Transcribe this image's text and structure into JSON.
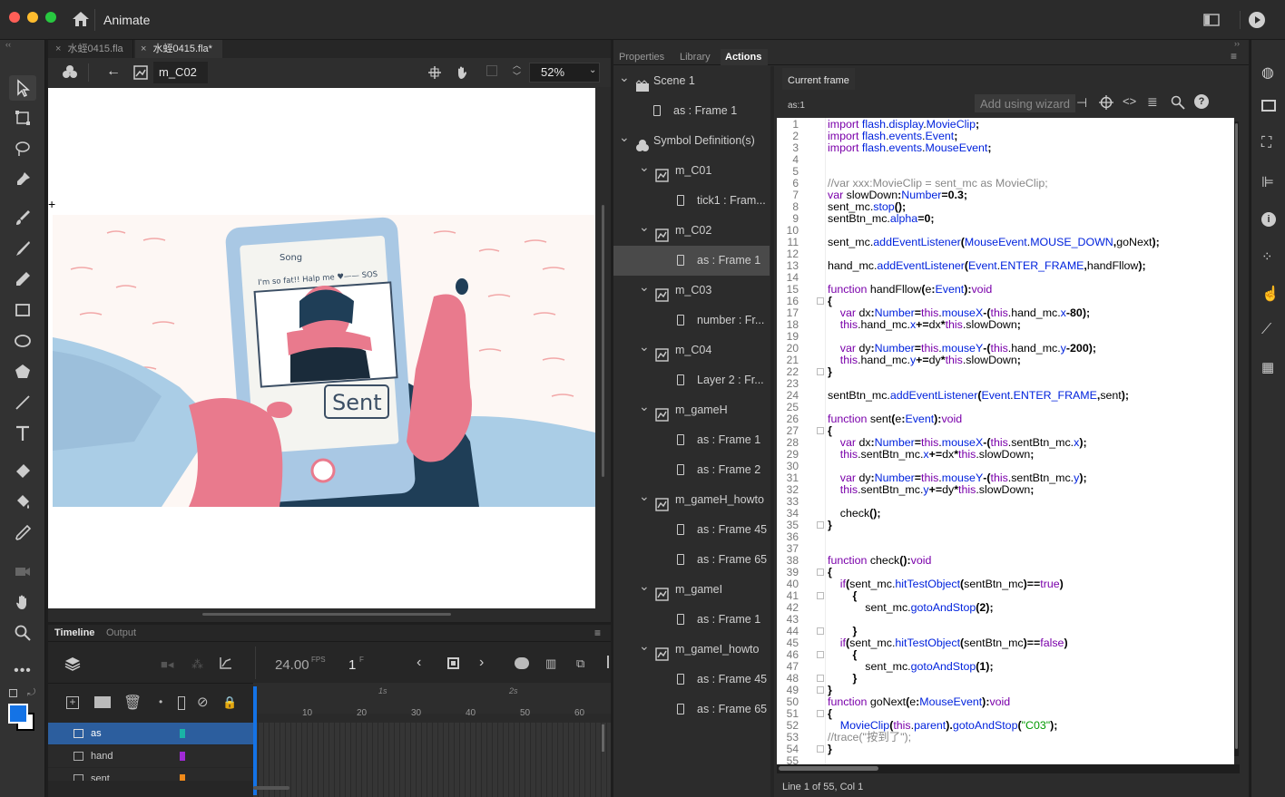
{
  "app": {
    "name": "Animate"
  },
  "doc_tabs": [
    {
      "label": "水蛭0415.fla"
    },
    {
      "label": "水蛭0415.fla*"
    }
  ],
  "stage": {
    "symbol_name": "m_C02",
    "zoom": "52%"
  },
  "panel_tabs": [
    {
      "label": "Properties"
    },
    {
      "label": "Library"
    },
    {
      "label": "Actions"
    }
  ],
  "tree": [
    {
      "label": "Scene 1",
      "level": 0,
      "kind": "scene"
    },
    {
      "label": "as : Frame 1",
      "level": 1,
      "kind": "frame"
    },
    {
      "label": "Symbol Definition(s)",
      "level": 0,
      "kind": "defs"
    },
    {
      "label": "m_C01",
      "level": 1,
      "kind": "symbol"
    },
    {
      "label": "tick1 : Fram...",
      "level": 2,
      "kind": "frame"
    },
    {
      "label": "m_C02",
      "level": 1,
      "kind": "symbol"
    },
    {
      "label": "as : Frame 1",
      "level": 2,
      "kind": "frame",
      "selected": true
    },
    {
      "label": "m_C03",
      "level": 1,
      "kind": "symbol"
    },
    {
      "label": "number : Fr...",
      "level": 2,
      "kind": "frame"
    },
    {
      "label": "m_C04",
      "level": 1,
      "kind": "symbol"
    },
    {
      "label": "Layer 2 : Fr...",
      "level": 2,
      "kind": "frame"
    },
    {
      "label": "m_gameH",
      "level": 1,
      "kind": "symbol"
    },
    {
      "label": "as : Frame 1",
      "level": 2,
      "kind": "frame"
    },
    {
      "label": "as : Frame 2",
      "level": 2,
      "kind": "frame"
    },
    {
      "label": "m_gameH_howto",
      "level": 1,
      "kind": "symbol"
    },
    {
      "label": "as : Frame 45",
      "level": 2,
      "kind": "frame"
    },
    {
      "label": "as : Frame 65",
      "level": 2,
      "kind": "frame"
    },
    {
      "label": "m_gameI",
      "level": 1,
      "kind": "symbol"
    },
    {
      "label": "as : Frame 1",
      "level": 2,
      "kind": "frame"
    },
    {
      "label": "m_gameI_howto",
      "level": 1,
      "kind": "symbol"
    },
    {
      "label": "as : Frame 45",
      "level": 2,
      "kind": "frame"
    },
    {
      "label": "as : Frame 65",
      "level": 2,
      "kind": "frame"
    }
  ],
  "actions": {
    "current_frame_tab": "Current frame",
    "frame_id": "as:1",
    "wizard_label": "Add using wizard",
    "status": "Line 1 of 55, Col 1",
    "code_lines": [
      "import flash.display.MovieClip;",
      "import flash.events.Event;",
      "import flash.events.MouseEvent;",
      "",
      "",
      "//var xxx:MovieClip = sent_mc as MovieClip;",
      "var slowDown:Number=0.3;",
      "sent_mc.stop();",
      "sentBtn_mc.alpha=0;",
      "",
      "sent_mc.addEventListener(MouseEvent.MOUSE_DOWN,goNext);",
      "",
      "hand_mc.addEventListener(Event.ENTER_FRAME,handFllow);",
      "",
      "function handFllow(e:Event):void",
      "{",
      "    var dx:Number=this.mouseX-(this.hand_mc.x-80);",
      "    this.hand_mc.x+=dx*this.slowDown;",
      "",
      "    var dy:Number=this.mouseY-(this.hand_mc.y-200);",
      "    this.hand_mc.y+=dy*this.slowDown;",
      "}",
      "",
      "sentBtn_mc.addEventListener(Event.ENTER_FRAME,sent);",
      "",
      "function sent(e:Event):void",
      "{",
      "    var dx:Number=this.mouseX-(this.sentBtn_mc.x);",
      "    this.sentBtn_mc.x+=dx*this.slowDown;",
      "",
      "    var dy:Number=this.mouseY-(this.sentBtn_mc.y);",
      "    this.sentBtn_mc.y+=dy*this.slowDown;",
      "",
      "    check();",
      "}",
      "",
      "",
      "function check():void",
      "{",
      "    if(sent_mc.hitTestObject(sentBtn_mc)==true)",
      "        {",
      "            sent_mc.gotoAndStop(2);",
      "",
      "        }",
      "    if(sent_mc.hitTestObject(sentBtn_mc)==false)",
      "        {",
      "            sent_mc.gotoAndStop(1);",
      "        }",
      "}",
      "function goNext(e:MouseEvent):void",
      "{",
      "    MovieClip(this.parent).gotoAndStop(\"C03\");",
      "    //trace(\"按到了\");",
      "}",
      ""
    ]
  },
  "timeline": {
    "tabs": [
      {
        "label": "Timeline"
      },
      {
        "label": "Output"
      }
    ],
    "fps": "24.00",
    "fps_unit": "FPS",
    "frame": "1",
    "frame_unit": "F",
    "ruler_seconds": [
      "1s",
      "2s"
    ],
    "ruler_frames": [
      "10",
      "20",
      "30",
      "40",
      "50",
      "60"
    ],
    "layers": [
      {
        "name": "as",
        "color": "#1ab3a6",
        "selected": true
      },
      {
        "name": "hand",
        "color": "#a02ad6"
      },
      {
        "name": "sent",
        "color": "#f08a1a"
      }
    ]
  },
  "artwork": {
    "phone_lines": [
      "Song",
      "I'm so fat!! Halp me ♥—— SOS",
      "Sent"
    ]
  },
  "colors": {
    "accent": "#1473e6",
    "selected_row": "#4a4a4a",
    "layer_selected": "#2c5e9e"
  }
}
